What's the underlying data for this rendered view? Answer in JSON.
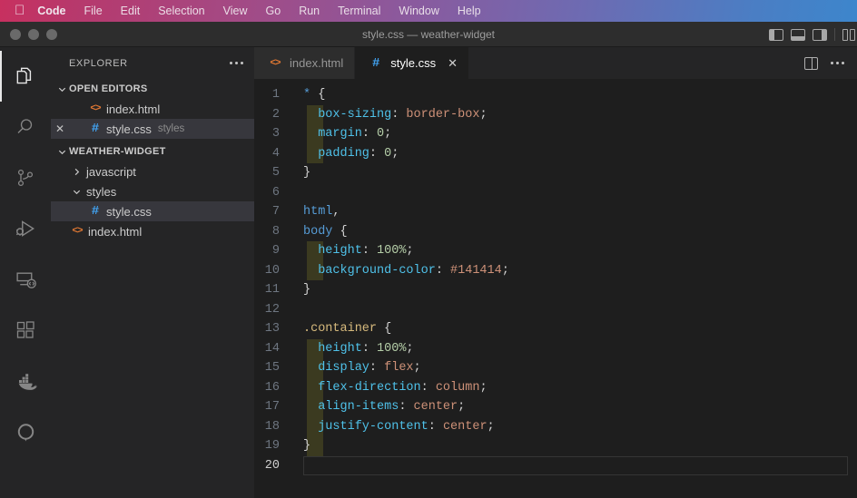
{
  "menubar": {
    "apple_icon": "apple-logo",
    "items": [
      {
        "label": "Code",
        "bold": true
      },
      {
        "label": "File",
        "bold": false
      },
      {
        "label": "Edit",
        "bold": false
      },
      {
        "label": "Selection",
        "bold": false
      },
      {
        "label": "View",
        "bold": false
      },
      {
        "label": "Go",
        "bold": false
      },
      {
        "label": "Run",
        "bold": false
      },
      {
        "label": "Terminal",
        "bold": false
      },
      {
        "label": "Window",
        "bold": false
      },
      {
        "label": "Help",
        "bold": false
      }
    ]
  },
  "titlebar": {
    "title": "style.css — weather-widget",
    "traffic_lights": [
      "close-button",
      "minimize-button",
      "maximize-button"
    ],
    "actions": [
      "toggle-primary-sidebar-icon",
      "toggle-panel-icon",
      "toggle-secondary-sidebar-icon",
      "customize-layout-icon"
    ]
  },
  "activitybar": {
    "items": [
      {
        "name": "explorer",
        "icon": "files-icon",
        "active": true
      },
      {
        "name": "search",
        "icon": "search-icon",
        "active": false
      },
      {
        "name": "source-control",
        "icon": "source-control-icon",
        "active": false
      },
      {
        "name": "run-and-debug",
        "icon": "run-debug-icon",
        "active": false
      },
      {
        "name": "remote-explorer",
        "icon": "remote-explorer-icon",
        "active": false
      },
      {
        "name": "extensions",
        "icon": "extensions-icon",
        "active": false
      },
      {
        "name": "docker",
        "icon": "docker-whale-icon",
        "active": false
      },
      {
        "name": "assistant",
        "icon": "circle-ring-icon",
        "active": false
      }
    ]
  },
  "sidebar": {
    "header": "EXPLORER",
    "more_actions": "more-actions-icon",
    "open_editors": {
      "title": "OPEN EDITORS",
      "expanded": true,
      "items": [
        {
          "name": "index.html",
          "icon": "html-file-icon",
          "description": "",
          "selected": false,
          "has_close": false
        },
        {
          "name": "style.css",
          "icon": "css-file-icon",
          "description": "styles",
          "selected": true,
          "has_close": true,
          "close_label": "✕"
        }
      ]
    },
    "workspace": {
      "title": "WEATHER-WIDGET",
      "expanded": true,
      "items": [
        {
          "name": "javascript",
          "type": "folder",
          "expanded": false,
          "selected": false,
          "icon": "chevron-right-icon"
        },
        {
          "name": "styles",
          "type": "folder",
          "expanded": true,
          "selected": false,
          "icon": "chevron-down-icon"
        },
        {
          "name": "style.css",
          "type": "file",
          "icon": "css-file-icon",
          "selected": true
        },
        {
          "name": "index.html",
          "type": "file",
          "icon": "html-file-icon",
          "selected": false
        }
      ]
    }
  },
  "editor": {
    "tabs": [
      {
        "label": "index.html",
        "icon": "html-file-icon",
        "active": false,
        "closable": false
      },
      {
        "label": "style.css",
        "icon": "css-file-icon",
        "active": true,
        "closable": true,
        "close_label": "✕"
      }
    ],
    "actions": [
      "split-editor-icon",
      "more-editor-actions-icon"
    ],
    "current_line": 20,
    "lines": [
      {
        "n": "1",
        "tokens": [
          {
            "t": "* ",
            "c": "tk-star"
          },
          {
            "t": "{",
            "c": "tk-punc"
          }
        ]
      },
      {
        "n": "2",
        "indent_guide": true,
        "tokens": [
          {
            "t": "  ",
            "c": "tk-punc"
          },
          {
            "t": "box-sizing",
            "c": "tk-prop"
          },
          {
            "t": ": ",
            "c": "tk-punc"
          },
          {
            "t": "border-box",
            "c": "tk-val"
          },
          {
            "t": ";",
            "c": "tk-punc"
          }
        ]
      },
      {
        "n": "3",
        "indent_guide": true,
        "tokens": [
          {
            "t": "  ",
            "c": "tk-punc"
          },
          {
            "t": "margin",
            "c": "tk-prop"
          },
          {
            "t": ": ",
            "c": "tk-punc"
          },
          {
            "t": "0",
            "c": "tk-num"
          },
          {
            "t": ";",
            "c": "tk-punc"
          }
        ]
      },
      {
        "n": "4",
        "indent_guide": true,
        "tokens": [
          {
            "t": "  ",
            "c": "tk-punc"
          },
          {
            "t": "padding",
            "c": "tk-prop"
          },
          {
            "t": ": ",
            "c": "tk-punc"
          },
          {
            "t": "0",
            "c": "tk-num"
          },
          {
            "t": ";",
            "c": "tk-punc"
          }
        ]
      },
      {
        "n": "5",
        "tokens": [
          {
            "t": "}",
            "c": "tk-punc"
          }
        ]
      },
      {
        "n": "6",
        "tokens": []
      },
      {
        "n": "7",
        "tokens": [
          {
            "t": "html",
            "c": "tk-sel"
          },
          {
            "t": ",",
            "c": "tk-punc"
          }
        ]
      },
      {
        "n": "8",
        "tokens": [
          {
            "t": "body",
            "c": "tk-sel"
          },
          {
            "t": " {",
            "c": "tk-punc"
          }
        ]
      },
      {
        "n": "9",
        "indent_guide": true,
        "tokens": [
          {
            "t": "  ",
            "c": "tk-punc"
          },
          {
            "t": "height",
            "c": "tk-prop"
          },
          {
            "t": ": ",
            "c": "tk-punc"
          },
          {
            "t": "100%",
            "c": "tk-num"
          },
          {
            "t": ";",
            "c": "tk-punc"
          }
        ]
      },
      {
        "n": "10",
        "indent_guide": true,
        "tokens": [
          {
            "t": "  ",
            "c": "tk-punc"
          },
          {
            "t": "background-color",
            "c": "tk-prop"
          },
          {
            "t": ": ",
            "c": "tk-punc"
          },
          {
            "t": "#141414",
            "c": "tk-val"
          },
          {
            "t": ";",
            "c": "tk-punc"
          }
        ]
      },
      {
        "n": "11",
        "tokens": [
          {
            "t": "}",
            "c": "tk-punc"
          }
        ]
      },
      {
        "n": "12",
        "tokens": []
      },
      {
        "n": "13",
        "tokens": [
          {
            "t": ".container",
            "c": "tk-class"
          },
          {
            "t": " {",
            "c": "tk-punc"
          }
        ]
      },
      {
        "n": "14",
        "indent_guide": true,
        "tokens": [
          {
            "t": "  ",
            "c": "tk-punc"
          },
          {
            "t": "height",
            "c": "tk-prop"
          },
          {
            "t": ": ",
            "c": "tk-punc"
          },
          {
            "t": "100%",
            "c": "tk-num"
          },
          {
            "t": ";",
            "c": "tk-punc"
          }
        ]
      },
      {
        "n": "15",
        "indent_guide": true,
        "tokens": [
          {
            "t": "  ",
            "c": "tk-punc"
          },
          {
            "t": "display",
            "c": "tk-prop"
          },
          {
            "t": ": ",
            "c": "tk-punc"
          },
          {
            "t": "flex",
            "c": "tk-val"
          },
          {
            "t": ";",
            "c": "tk-punc"
          }
        ]
      },
      {
        "n": "16",
        "indent_guide": true,
        "tokens": [
          {
            "t": "  ",
            "c": "tk-punc"
          },
          {
            "t": "flex-direction",
            "c": "tk-prop"
          },
          {
            "t": ": ",
            "c": "tk-punc"
          },
          {
            "t": "column",
            "c": "tk-val"
          },
          {
            "t": ";",
            "c": "tk-punc"
          }
        ]
      },
      {
        "n": "17",
        "indent_guide": true,
        "tokens": [
          {
            "t": "  ",
            "c": "tk-punc"
          },
          {
            "t": "align-items",
            "c": "tk-prop"
          },
          {
            "t": ": ",
            "c": "tk-punc"
          },
          {
            "t": "center",
            "c": "tk-val"
          },
          {
            "t": ";",
            "c": "tk-punc"
          }
        ]
      },
      {
        "n": "18",
        "indent_guide": true,
        "tokens": [
          {
            "t": "  ",
            "c": "tk-punc"
          },
          {
            "t": "justify-content",
            "c": "tk-prop"
          },
          {
            "t": ": ",
            "c": "tk-punc"
          },
          {
            "t": "center",
            "c": "tk-val"
          },
          {
            "t": ";",
            "c": "tk-punc"
          }
        ]
      },
      {
        "n": "19",
        "indent_guide": true,
        "tokens": [
          {
            "t": "}",
            "c": "tk-punc"
          }
        ]
      },
      {
        "n": "20",
        "current": true,
        "tokens": []
      }
    ]
  },
  "colors": {
    "editor_bg": "#1e1e1e",
    "sidebar_bg": "#252526",
    "titlebar_bg": "#2d2d2d",
    "selection_bg": "#37373d",
    "html_icon": "#e37933",
    "css_icon": "#42a5f5",
    "indent_guide": "#3b3a20"
  }
}
